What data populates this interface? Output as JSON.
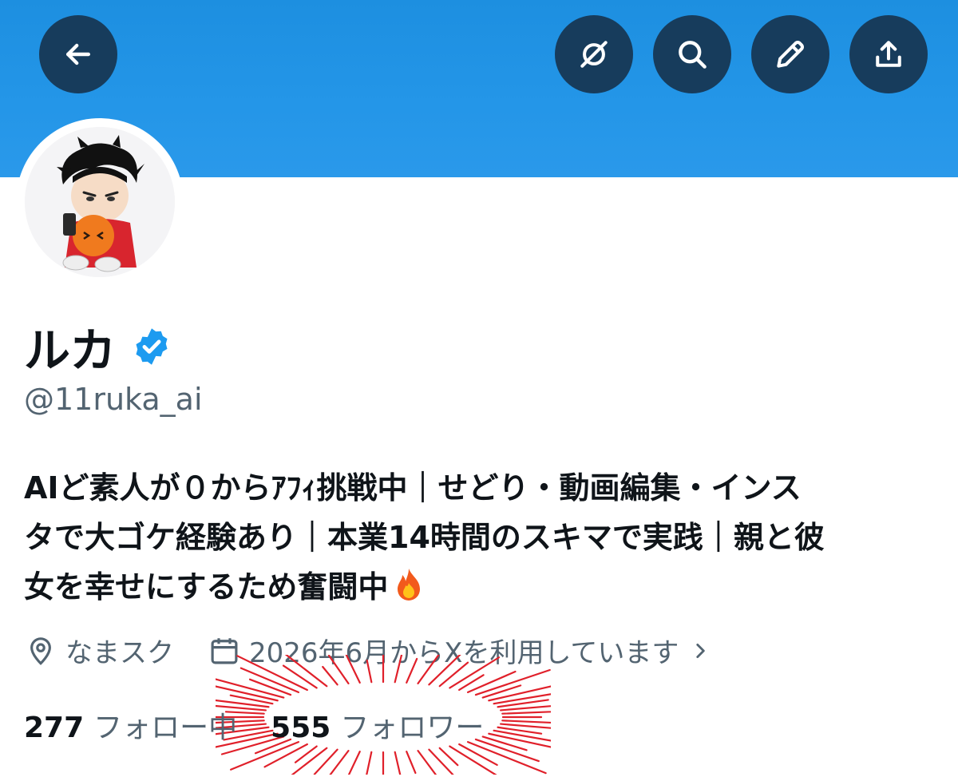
{
  "profile": {
    "name": "ルカ",
    "handle": "@11ruka_ai",
    "bio_lines": [
      "AIど素人が０からｱﾌｨ挑戦中｜せどり・動画編集・インス",
      "タで大ゴケ経験あり｜本業14時間のスキマで実践｜親と彼",
      "女を幸せにするため奮闘中"
    ],
    "location": "なまスク",
    "joined": "2026年6月からXを利用しています",
    "following_count": "277",
    "following_label": "フォロー中",
    "followers_count": "555",
    "followers_label": "フォロワー"
  },
  "icons": {
    "back": "back-arrow-icon",
    "grok": "grok-icon",
    "search": "search-icon",
    "edit": "pencil-icon",
    "share": "share-icon",
    "verified": "verified-badge-icon",
    "location": "location-pin-icon",
    "calendar": "calendar-icon",
    "fire": "fire-emoji"
  },
  "colors": {
    "banner": "#1d8fe0",
    "button_bg": "#173c5c",
    "verified": "#1d9bf0",
    "muted": "#536471",
    "text": "#0f1419",
    "burst": "#e0202a"
  }
}
